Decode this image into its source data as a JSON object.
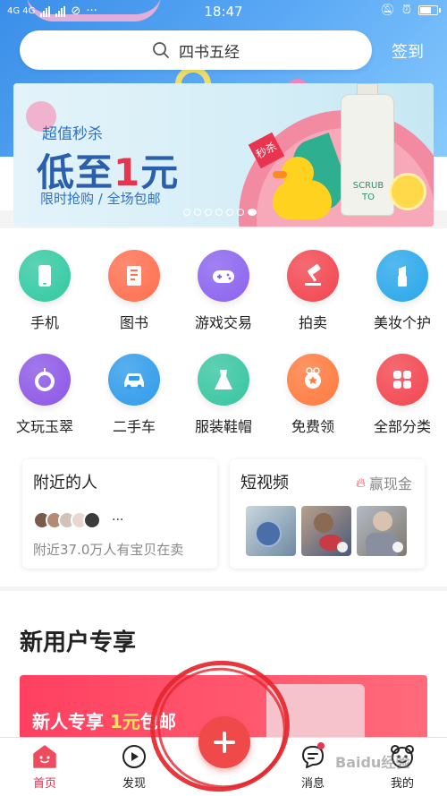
{
  "status_bar": {
    "network": "4G 4G",
    "time": "18:47"
  },
  "search": {
    "text": "四书五经"
  },
  "header": {
    "checkin_label": "签到"
  },
  "banner": {
    "tag": "超值秒杀",
    "headline_prefix": "低至",
    "headline_number": "1",
    "headline_suffix": "元",
    "sub": "限时抢购 / 全场包邮",
    "flag": "秒杀",
    "bottle_text": "SCRUB TO",
    "page_indicator": {
      "pages": 7,
      "active": 6
    }
  },
  "categories": [
    {
      "label": "手机",
      "icon": "phone-icon",
      "color": "#32c9a1"
    },
    {
      "label": "图书",
      "icon": "book-icon",
      "color": "#ff6e4e"
    },
    {
      "label": "游戏交易",
      "icon": "gamepad-icon",
      "color": "#8a62ee"
    },
    {
      "label": "拍卖",
      "icon": "gavel-icon",
      "color": "#f2454f"
    },
    {
      "label": "美妆个护",
      "icon": "lipstick-icon",
      "color": "#29a7ea"
    },
    {
      "label": "文玩玉翠",
      "icon": "jade-icon",
      "color": "#8c56e6"
    },
    {
      "label": "二手车",
      "icon": "car-icon",
      "color": "#2f9bea"
    },
    {
      "label": "服装鞋帽",
      "icon": "dress-icon",
      "color": "#36c5a0"
    },
    {
      "label": "免费领",
      "icon": "gift-icon",
      "color": "#ff7a3d"
    },
    {
      "label": "全部分类",
      "icon": "grid-icon",
      "color": "#f2454f"
    }
  ],
  "nearby": {
    "title": "附近的人",
    "more": "···",
    "desc": "附近37.0万人有宝贝在卖"
  },
  "short_video": {
    "title": "短视频",
    "win_cash": "赢现金"
  },
  "new_user": {
    "title": "新用户专享",
    "promo_prefix": "新人专享 ",
    "promo_highlight": "1元",
    "promo_suffix": "包邮"
  },
  "tabbar": {
    "home": "首页",
    "discover": "发现",
    "messages": "消息",
    "mine": "我的"
  },
  "colors": {
    "accent": "#e8344f",
    "publish": "#f0494a",
    "annotation": "#e5262d"
  },
  "watermark": "Baidu经验"
}
